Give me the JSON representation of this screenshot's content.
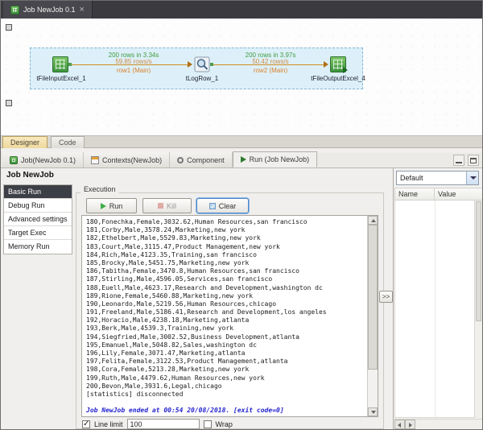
{
  "window": {
    "job_tab": "Job NewJob 0.1",
    "close_label": "×"
  },
  "colors": {
    "connection_orange": "#cf8a1f",
    "stats_green": "#3f9b3f",
    "console_message_blue": "#2323cf",
    "designer_tab_tan": "#eed89c",
    "selection_fill": "#d4ecf8",
    "component_green": "#3d9340"
  },
  "canvas": {
    "components": [
      {
        "label": "tFileInputExcel_1"
      },
      {
        "label": "tLogRow_1"
      },
      {
        "label": "tFileOutputExcel_4"
      }
    ],
    "connections": [
      {
        "stats": "200 rows in 3.34s",
        "rate": "59.85 rows/s",
        "label": "row1 (Main)"
      },
      {
        "stats": "200 rows in 3.97s",
        "rate": "50.42 rows/s",
        "label": "row2 (Main)"
      }
    ]
  },
  "view_tabs": {
    "designer": "Designer",
    "code": "Code"
  },
  "panel_tabs": [
    {
      "label": "Job(NewJob 0.1)"
    },
    {
      "label": "Contexts(NewJob)"
    },
    {
      "label": "Component"
    },
    {
      "label": "Run (Job NewJob)"
    }
  ],
  "run": {
    "title": "Job NewJob",
    "sidebar": [
      {
        "label": "Basic Run"
      },
      {
        "label": "Debug Run"
      },
      {
        "label": "Advanced settings"
      },
      {
        "label": "Target Exec"
      },
      {
        "label": "Memory Run"
      }
    ],
    "execution_label": "Execution",
    "buttons": {
      "run": "Run",
      "kill": "Kill",
      "clear": "Clear"
    },
    "console_lines": [
      "180,Fonechka,Female,3032.62,Human Resources,san francisco",
      "181,Corby,Male,3578.24,Marketing,new york",
      "182,Ethelbert,Male,5529.83,Marketing,new york",
      "183,Court,Male,3115.47,Product Management,new york",
      "184,Rich,Male,4123.35,Training,san francisco",
      "185,Brocky,Male,5451.75,Marketing,new york",
      "186,Tabitha,Female,3470.8,Human Resources,san francisco",
      "187,Stirling,Male,4596.05,Services,san francisco",
      "188,Euell,Male,4623.17,Research and Development,washington dc",
      "189,Rione,Female,5460.88,Marketing,new york",
      "190,Leonardo,Male,5219.56,Human Resources,chicago",
      "191,Freeland,Male,5186.41,Research and Development,los angeles",
      "192,Horacio,Male,4238.18,Marketing,atlanta",
      "193,Berk,Male,4539.3,Training,new york",
      "194,Siegfried,Male,3002.52,Business Development,atlanta",
      "195,Emanuel,Male,5048.82,Sales,washington dc",
      "196,Lily,Female,3071.47,Marketing,atlanta",
      "197,Felita,Female,3122.53,Product Management,atlanta",
      "198,Cora,Female,5213.28,Marketing,new york",
      "199,Ruth,Male,4479.62,Human Resources,new york",
      "200,Bevon,Male,3931.6,Legal,chicago",
      "[statistics] disconnected"
    ],
    "ended_message": "Job NewJob ended at 00:54 20/08/2018. [exit code=0]",
    "line_limit_label": "Line limit",
    "line_limit_value": "100",
    "wrap_label": "Wrap",
    "expand_button": ">>"
  },
  "right_panel": {
    "context_dropdown": "Default",
    "columns": [
      {
        "label": "Name"
      },
      {
        "label": "Value"
      }
    ]
  }
}
